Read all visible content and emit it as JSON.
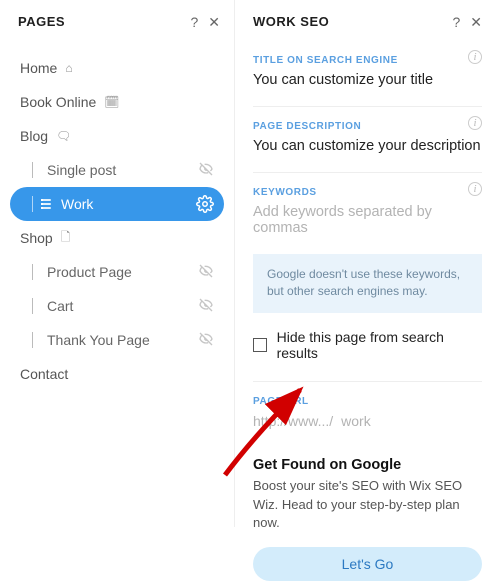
{
  "left": {
    "title": "PAGES",
    "items": [
      {
        "label": "Home",
        "icon": "⌂",
        "child": false,
        "active": false,
        "right": ""
      },
      {
        "label": "Book Online",
        "icon": "🗓",
        "child": false,
        "active": false,
        "right": ""
      },
      {
        "label": "Blog",
        "icon": "🗨",
        "child": false,
        "active": false,
        "right": ""
      },
      {
        "label": "Single post",
        "icon": "",
        "child": true,
        "active": false,
        "right": "hidden"
      },
      {
        "label": "Work",
        "icon": "",
        "child": true,
        "active": true,
        "right": "gear"
      },
      {
        "label": "Shop",
        "icon": "🗋",
        "child": false,
        "active": false,
        "right": ""
      },
      {
        "label": "Product Page",
        "icon": "",
        "child": true,
        "active": false,
        "right": "hidden"
      },
      {
        "label": "Cart",
        "icon": "",
        "child": true,
        "active": false,
        "right": "hidden"
      },
      {
        "label": "Thank You Page",
        "icon": "",
        "child": true,
        "active": false,
        "right": "hidden"
      },
      {
        "label": "Contact",
        "icon": "",
        "child": false,
        "active": false,
        "right": ""
      }
    ]
  },
  "right": {
    "title": "WORK SEO",
    "title_label": "TITLE ON SEARCH ENGINE",
    "title_value": "You can customize your title",
    "desc_label": "PAGE DESCRIPTION",
    "desc_value": "You can customize your description",
    "keywords_label": "KEYWORDS",
    "keywords_placeholder": "Add keywords separated by commas",
    "note": "Google doesn't use these keywords, but other search engines may.",
    "hide_label": "Hide this page from search results",
    "url_label": "PAGE URL",
    "url_prefix": "http://www.../",
    "url_value": "work",
    "cta_title": "Get Found on Google",
    "cta_text": "Boost your site's SEO with Wix SEO Wiz. Head to your step-by-step plan now.",
    "cta_button": "Let's Go"
  }
}
